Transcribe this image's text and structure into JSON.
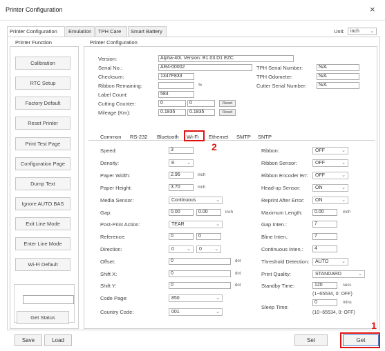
{
  "window": {
    "title": "Printer Configuration",
    "close_glyph": "×"
  },
  "tabs": [
    {
      "label": "Printer Configuration"
    },
    {
      "label": "Emulation"
    },
    {
      "label": "TPH Care"
    },
    {
      "label": "Smart Battery"
    }
  ],
  "unit": {
    "label": "Unit:",
    "value": "inch"
  },
  "printer_function": {
    "title": "Printer Function",
    "buttons": [
      "Calibration",
      "RTC Setup",
      "Factory Default",
      "Reset Printer",
      "Print Test Page",
      "Configuration Page",
      "Dump Text",
      "Ignore AUTO.BAS",
      "Exit Line Mode",
      "Enter Line Mode",
      "Wi-Fi Default"
    ],
    "status_value": "",
    "get_status": "Get Status"
  },
  "printer_configuration": {
    "title": "Printer Configuration",
    "version": {
      "label": "Version:",
      "value": "Alpha-40L Version: B1.03.D1 EZC"
    },
    "serial_no": {
      "label": "Serial No.:",
      "value": "AR4-00002"
    },
    "checksum": {
      "label": "Checksum:",
      "value": "1347F833"
    },
    "ribbon_remaining": {
      "label": "Ribbon Remaining:",
      "value": "",
      "unit": "%"
    },
    "label_count": {
      "label": "Label Count:",
      "value": "584"
    },
    "cutting_counter": {
      "label": "Cutting Counter:",
      "value1": "0",
      "value2": "0",
      "reset": "Reset"
    },
    "mileage": {
      "label": "Mileage (Km):",
      "value1": "0.1835",
      "value2": "0.1835",
      "reset": "Reset"
    },
    "tph_serial": {
      "label": "TPH Serial Number:",
      "value": "N/A"
    },
    "tph_odometer": {
      "label": "TPH Odometer:",
      "value": "N/A"
    },
    "cutter_serial": {
      "label": "Cutter Serial Number:",
      "value": "N/A"
    }
  },
  "subtabs": [
    "Common",
    "RS-232",
    "Bluetooth",
    "Wi-Fi",
    "Ethernet",
    "SMTP",
    "SNTP"
  ],
  "common": {
    "left": [
      {
        "label": "Speed:",
        "value": "3"
      },
      {
        "label": "Density:",
        "value": "8"
      },
      {
        "label": "Paper Width:",
        "value": "2.96",
        "unit": "inch"
      },
      {
        "label": "Paper Height:",
        "value": "3.70",
        "unit": "inch"
      },
      {
        "label": "Media Sensor:",
        "value": "Continuous"
      },
      {
        "label": "Gap:",
        "value1": "0.00",
        "value2": "0.00",
        "unit": "inch"
      },
      {
        "label": "Post-Print Action:",
        "value": "TEAR"
      },
      {
        "label": "Reference:",
        "value1": "0",
        "value2": "0"
      },
      {
        "label": "Direction:",
        "value1": "0",
        "value2": "0"
      },
      {
        "label": "Offset:",
        "value": "0",
        "unit": "dot"
      },
      {
        "label": "Shift X:",
        "value": "0",
        "unit": "dot"
      },
      {
        "label": "Shift Y:",
        "value": "0",
        "unit": "dot"
      },
      {
        "label": "Code Page:",
        "value": "850"
      },
      {
        "label": "Country Code:",
        "value": "001"
      }
    ],
    "right": [
      {
        "label": "Ribbon:",
        "value": "OFF"
      },
      {
        "label": "Ribbon Sensor:",
        "value": "OFF"
      },
      {
        "label": "Ribbon Encoder Err:",
        "value": "OFF"
      },
      {
        "label": "Head-up Sensor:",
        "value": "ON"
      },
      {
        "label": "Reprint After Error:",
        "value": "ON"
      },
      {
        "label": "Maximum Length:",
        "value": "0.00",
        "unit": "inch"
      },
      {
        "label": "Gap Inten.:",
        "value": "7"
      },
      {
        "label": "Bline Inten.:",
        "value": "7"
      },
      {
        "label": "Continuous Inten.:",
        "value": "4"
      },
      {
        "label": "Threshold Detection:",
        "value": "AUTO"
      },
      {
        "label": "Print Quality:",
        "value": "STANDARD"
      },
      {
        "label": "Standby Time:",
        "value": "120",
        "unit": "secs",
        "hint": "(1~65534, 0: OFF)"
      },
      {
        "label": "Sleep Time:",
        "value": "0",
        "unit": "mins",
        "hint": "(10~65534, 0: OFF)"
      }
    ]
  },
  "footer": {
    "save": "Save",
    "load": "Load",
    "set": "Set",
    "get": "Get"
  },
  "annotations": {
    "one": "1",
    "two": "2",
    "color": "#e01010"
  }
}
